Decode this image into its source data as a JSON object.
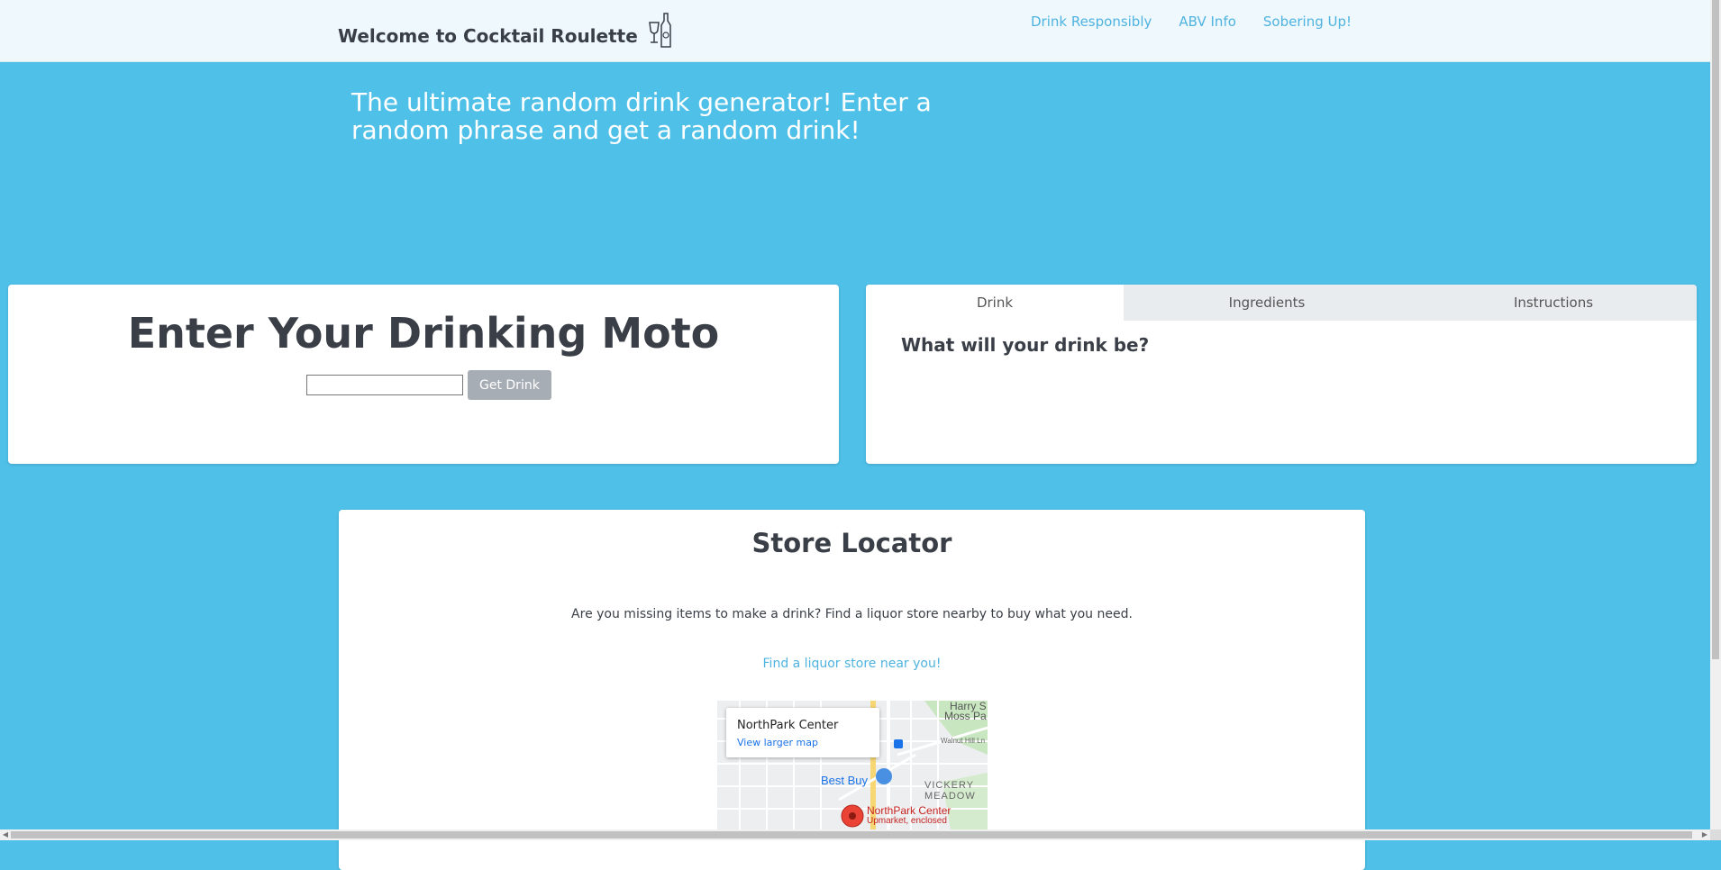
{
  "nav": {
    "brand": "Welcome to Cocktail Roulette",
    "links": [
      "Drink Responsibly",
      "ABV Info",
      "Sobering Up!"
    ]
  },
  "hero": {
    "tagline": "The ultimate random drink generator! Enter a random phrase and get a random drink!"
  },
  "moto": {
    "title": "Enter Your Drinking Moto",
    "input_value": "",
    "button": "Get Drink"
  },
  "drink_panel": {
    "tabs": [
      "Drink",
      "Ingredients",
      "Instructions"
    ],
    "active_tab": "Drink",
    "question": "What will your drink be?"
  },
  "store": {
    "title": "Store Locator",
    "description": "Are you missing items to make a drink? Find a liquor store nearby to buy what you need.",
    "link": "Find a liquor store near you!",
    "map": {
      "popup_title": "NorthPark Center",
      "popup_link": "View larger map",
      "labels": {
        "best_buy": "Best Buy",
        "vickery": "VICKERY",
        "meadow": "MEADOW",
        "northpark": "NorthPark Center",
        "northpark_sub": "Upmarket, enclosed",
        "harry": "Harry S",
        "moss": "Moss Pa",
        "walnut": "Walnut Hill Ln"
      }
    }
  },
  "colors": {
    "background": "#4fc0e8",
    "link": "#4fb3e0",
    "button": "#a7adb5"
  }
}
